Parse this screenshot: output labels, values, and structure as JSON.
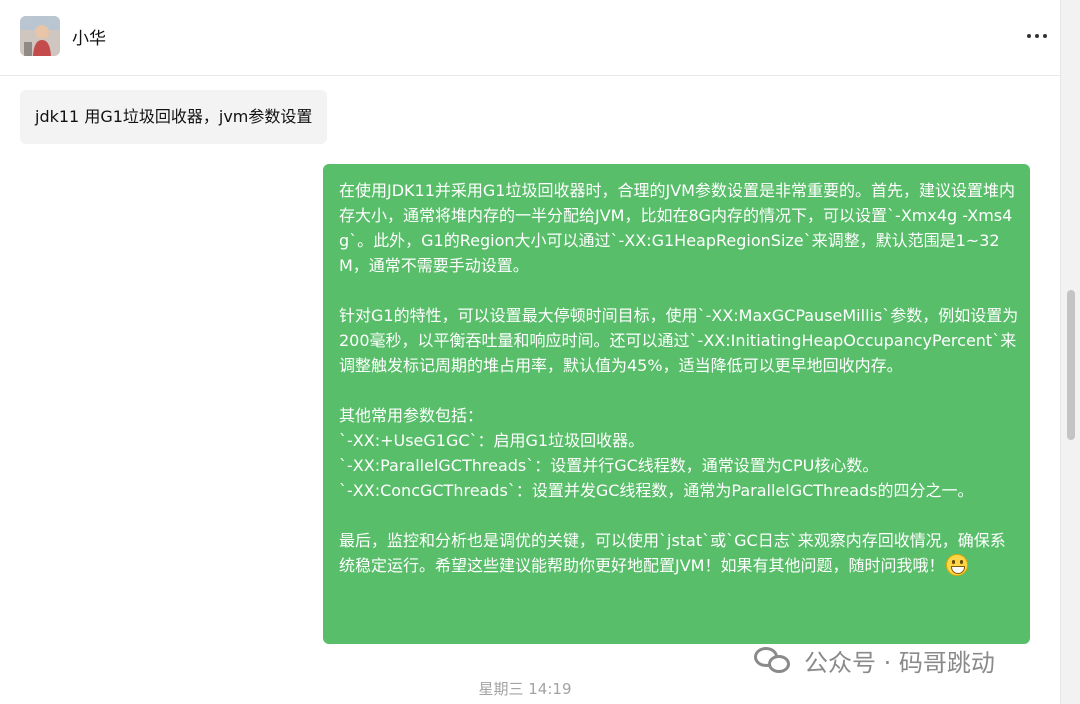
{
  "header": {
    "contact_name": "小华",
    "avatar_icon": "avatar-photo",
    "more_icon": "more-dots-icon"
  },
  "messages": {
    "user": "jdk11 用G1垃圾回收器，jvm参数设置",
    "reply": [
      "在使用JDK11并采用G1垃圾回收器时，合理的JVM参数设置是非常重要的。首先，建议设置堆内存大小，通常将堆内存的一半分配给JVM，比如在8G内存的情况下，可以设置`-Xmx4g -Xms4g`。此外，G1的Region大小可以通过`-XX:G1HeapRegionSize`来调整，默认范围是1~32M，通常不需要手动设置。",
      "针对G1的特性，可以设置最大停顿时间目标，使用`-XX:MaxGCPauseMillis`参数，例如设置为200毫秒，以平衡吞吐量和响应时间。还可以通过`-XX:InitiatingHeapOccupancyPercent`来调整触发标记周期的堆占用率，默认值为45%，适当降低可以更早地回收内存。",
      "其他常用参数包括：",
      "`-XX:+UseG1GC`：启用G1垃圾回收器。",
      "`-XX:ParallelGCThreads`：设置并行GC线程数，通常设置为CPU核心数。",
      "`-XX:ConcGCThreads`：设置并发GC线程数，通常为ParallelGCThreads的四分之一。",
      "最后，监控和分析也是调优的关键，可以使用`jstat`或`GC日志`来观察内存回收情况，确保系统稳定运行。希望这些建议能帮助你更好地配置JVM！如果有其他问题，随时问我哦！"
    ],
    "emoji": "grinning-face-emoji"
  },
  "timestamp": "星期三 14:19",
  "watermark": "公众号 · 码哥跳动",
  "colors": {
    "bubble_green": "#58be6a",
    "bubble_gray": "#f3f3f3",
    "timestamp": "#a3a3a3"
  }
}
